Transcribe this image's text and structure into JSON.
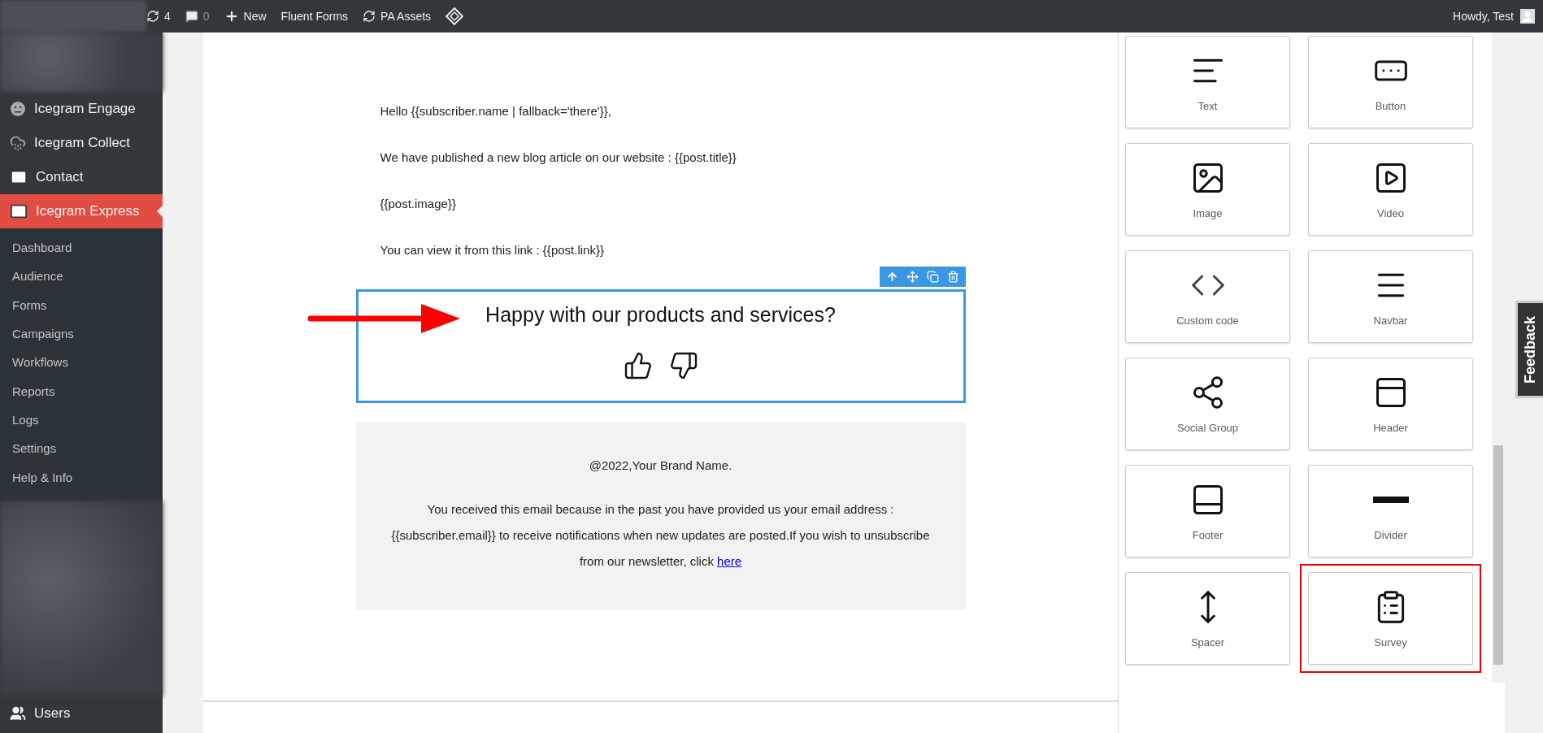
{
  "top_bar": {
    "items": [
      {
        "kind": "updates",
        "label": "4"
      },
      {
        "kind": "comments",
        "label": "0"
      },
      {
        "kind": "new",
        "label": "New"
      },
      {
        "kind": "text",
        "label": "Fluent Forms"
      },
      {
        "kind": "sync",
        "label": "PA Assets"
      },
      {
        "kind": "logo"
      }
    ],
    "greeting": "Howdy, Test"
  },
  "sidebar": {
    "items": [
      {
        "kind": "face",
        "label": "Icegram Engage",
        "selected": false
      },
      {
        "kind": "cloud",
        "label": "Icegram Collect",
        "selected": false
      },
      {
        "kind": "mail",
        "label": "Contact",
        "selected": false
      },
      {
        "kind": "mail",
        "label": "Icegram Express",
        "selected": true
      }
    ],
    "submenu": [
      "Dashboard",
      "Audience",
      "Forms",
      "Campaigns",
      "Workflows",
      "Reports",
      "Logs",
      "Settings",
      "Help & Info"
    ],
    "bottom_items": [
      {
        "kind": "users",
        "label": "Users"
      }
    ]
  },
  "email": {
    "lines": [
      "Hello {{subscriber.name | fallback='there'}},",
      "We have published a new blog article on our website : {{post.title}}",
      "{{post.image}}",
      "You can view it from this link : {{post.link}}"
    ],
    "survey": {
      "question": "Happy with our products and services?"
    },
    "footer": {
      "copyright": "@2022,Your Brand Name.",
      "notice": "You received this email because in the past you have provided us your email address : {{subscriber.email}} to receive notifications when new updates are posted.If you wish to unsubscribe from our newsletter, click ",
      "link": "here"
    }
  },
  "blocks": [
    {
      "kind": "text",
      "label": "Text",
      "highlighted": false
    },
    {
      "kind": "button",
      "label": "Button",
      "highlighted": false
    },
    {
      "kind": "image",
      "label": "Image",
      "highlighted": false
    },
    {
      "kind": "video",
      "label": "Video",
      "highlighted": false
    },
    {
      "kind": "code",
      "label": "Custom code",
      "highlighted": false
    },
    {
      "kind": "navbar",
      "label": "Navbar",
      "highlighted": false
    },
    {
      "kind": "share",
      "label": "Social Group",
      "highlighted": false
    },
    {
      "kind": "header",
      "label": "Header",
      "highlighted": false
    },
    {
      "kind": "footer",
      "label": "Footer",
      "highlighted": false
    },
    {
      "kind": "divider",
      "label": "Divider",
      "highlighted": false
    },
    {
      "kind": "spacer",
      "label": "Spacer",
      "highlighted": false
    },
    {
      "kind": "survey",
      "label": "Survey",
      "highlighted": true
    }
  ],
  "feedback_tab": "Feedback"
}
